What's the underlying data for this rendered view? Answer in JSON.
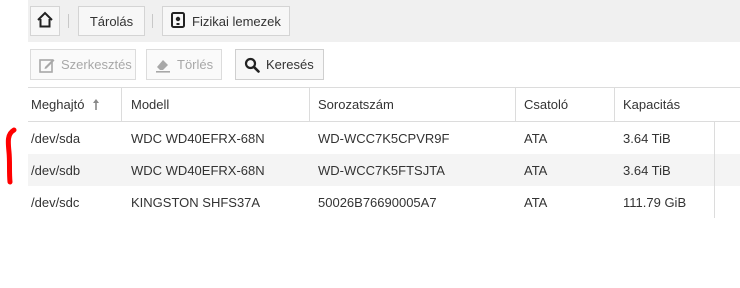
{
  "breadcrumb": {
    "home_icon": "home-icon",
    "storage_label": "Tárolás",
    "disks_label": "Fizikai lemezek",
    "disks_icon": "disk-icon"
  },
  "toolbar": {
    "edit_label": "Szerkesztés",
    "edit_icon": "edit-icon",
    "delete_label": "Törlés",
    "delete_icon": "eraser-icon",
    "search_label": "Keresés",
    "search_icon": "search-icon"
  },
  "table": {
    "columns": {
      "device": "Meghajtó",
      "model": "Modell",
      "serial": "Sorozatszám",
      "port": "Csatoló",
      "capacity": "Kapacitás"
    },
    "sort": {
      "column": "device",
      "direction": "ascending"
    },
    "rows": [
      {
        "device": "/dev/sda",
        "model": "WDC WD40EFRX-68N",
        "serial": "WD-WCC7K5CPVR9F",
        "port": "ATA",
        "capacity": "3.64 TiB"
      },
      {
        "device": "/dev/sdb",
        "model": "WDC WD40EFRX-68N",
        "serial": "WD-WCC7K5FTSJTA",
        "port": "ATA",
        "capacity": "3.64 TiB"
      },
      {
        "device": "/dev/sdc",
        "model": "KINGSTON SHFS37A",
        "serial": "50026B76690005A7",
        "port": "ATA",
        "capacity": "111.79 GiB"
      }
    ]
  },
  "colors": {
    "annotation": "#ff0000",
    "header_bg": "#f0f0f0",
    "alt_row_bg": "#f4f4f4"
  }
}
